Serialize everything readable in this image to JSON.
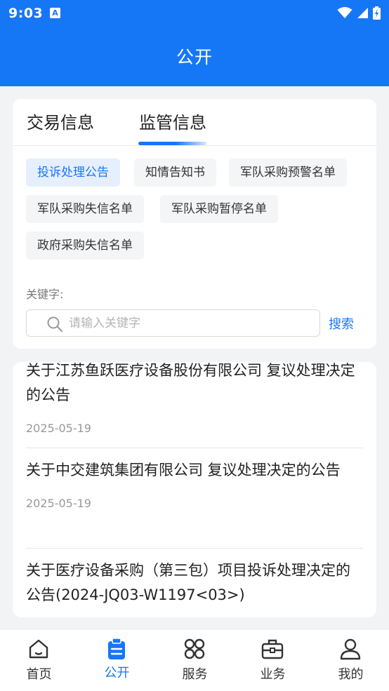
{
  "status_bar": {
    "time": "9:03",
    "app_badge": "A"
  },
  "header": {
    "title": "公开"
  },
  "tabs": [
    {
      "label": "交易信息"
    },
    {
      "label": "监管信息"
    }
  ],
  "chips": [
    {
      "label": "投诉处理公告"
    },
    {
      "label": "知情告知书"
    },
    {
      "label": "军队采购预警名单"
    },
    {
      "label": "军队采购失信名单"
    },
    {
      "label": "军队采购暂停名单"
    },
    {
      "label": "政府采购失信名单"
    }
  ],
  "search": {
    "label": "关键字:",
    "placeholder": "请输入关键字",
    "value": "",
    "button": "搜索"
  },
  "list": [
    {
      "title": "关于江苏鱼跃医疗设备股份有限公司 复议处理决定的公告",
      "date": "2025-05-19"
    },
    {
      "title": "关于中交建筑集团有限公司 复议处理决定的公告",
      "date": "2025-05-19"
    },
    {
      "title": "关于医疗设备采购（第三包）项目投诉处理决定的公告(2024-JQ03-W1197<03>)",
      "date": ""
    }
  ],
  "bottom_nav": [
    {
      "label": "首页",
      "icon": "home-icon"
    },
    {
      "label": "公开",
      "icon": "clipboard-icon"
    },
    {
      "label": "服务",
      "icon": "apps-icon"
    },
    {
      "label": "业务",
      "icon": "briefcase-icon"
    },
    {
      "label": "我的",
      "icon": "user-icon"
    }
  ],
  "colors": {
    "primary": "#1677f6",
    "background": "#f2f3f5",
    "chip_active_bg": "#e6effd"
  }
}
